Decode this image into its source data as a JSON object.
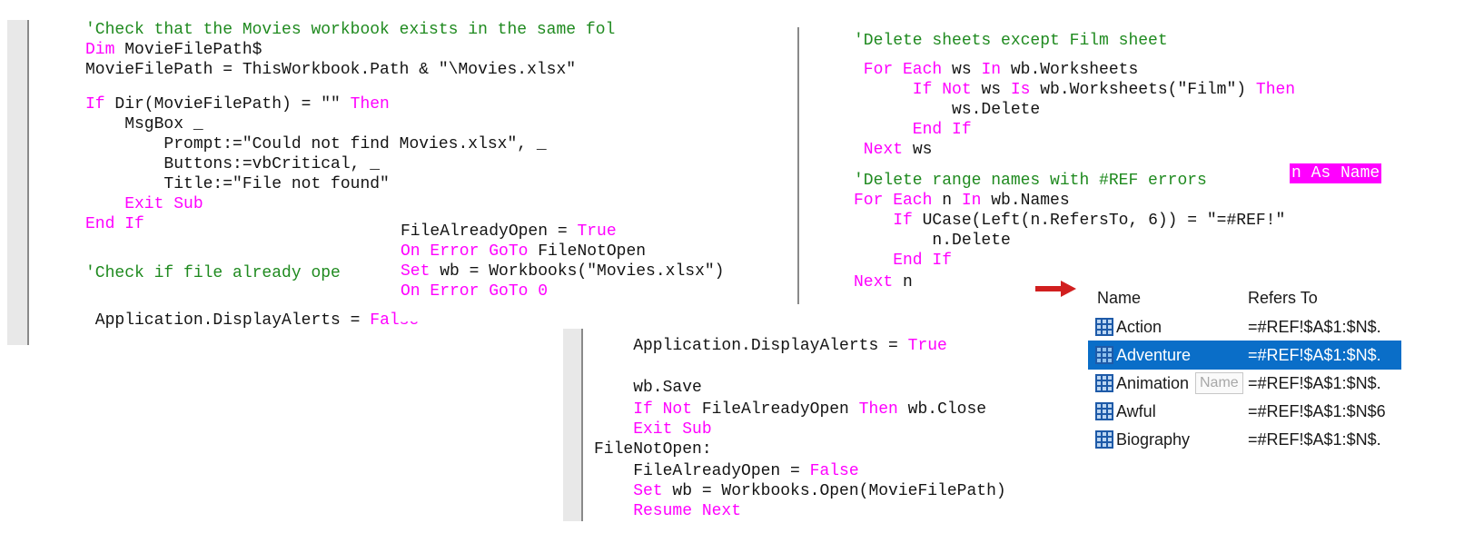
{
  "colors": {
    "keyword": "#ff00ff",
    "comment": "#1f8a1f",
    "text": "#141414",
    "gutter": "#e8e8e8",
    "selection": "#0a6ec8",
    "arrow": "#d11f1f"
  },
  "panel1": {
    "lines": [
      {
        "parts": [
          {
            "t": "c",
            "v": "'Check that the Movies workbook exists in the same fol"
          }
        ]
      },
      {
        "parts": [
          {
            "t": "k",
            "v": "Dim "
          },
          {
            "t": "s",
            "v": "MovieFilePath$"
          }
        ]
      },
      {
        "parts": [
          {
            "t": "s",
            "v": "MovieFilePath = ThisWorkbook.Path & \"\\Movies.xlsx\""
          }
        ]
      },
      {
        "parts": [
          {
            "t": "k",
            "v": "If "
          },
          {
            "t": "s",
            "v": "Dir(MovieFilePath) = \"\" "
          },
          {
            "t": "k",
            "v": "Then"
          }
        ]
      },
      {
        "parts": [
          {
            "t": "s",
            "v": "    MsgBox _"
          }
        ]
      },
      {
        "parts": [
          {
            "t": "s",
            "v": "        Prompt:=\"Could not find Movies.xlsx\", _"
          }
        ]
      },
      {
        "parts": [
          {
            "t": "s",
            "v": "        Buttons:=vbCritical, _"
          }
        ]
      },
      {
        "parts": [
          {
            "t": "s",
            "v": "        Title:=\"File not found\""
          }
        ]
      },
      {
        "parts": [
          {
            "t": "k",
            "v": "    Exit Sub"
          }
        ]
      },
      {
        "parts": [
          {
            "t": "k",
            "v": "End If"
          }
        ]
      },
      {
        "parts": [
          {
            "t": "c",
            "v": "'Check if file already ope"
          }
        ]
      },
      {
        "parts": [
          {
            "t": "s",
            "v": " Application.DisplayAlerts = "
          },
          {
            "t": "k",
            "v": "False"
          }
        ]
      }
    ],
    "inset_lines": [
      {
        "parts": [
          {
            "t": "s",
            "v": "FileAlreadyOpen = "
          },
          {
            "t": "k",
            "v": "True"
          }
        ]
      },
      {
        "parts": [
          {
            "t": "k",
            "v": "On Error GoTo "
          },
          {
            "t": "s",
            "v": "FileNotOpen"
          }
        ]
      },
      {
        "parts": [
          {
            "t": "k",
            "v": "Set "
          },
          {
            "t": "s",
            "v": "wb = Workbooks(\"Movies.xlsx\")"
          }
        ]
      },
      {
        "parts": [
          {
            "t": "k",
            "v": "On Error GoTo 0"
          }
        ]
      }
    ]
  },
  "panel2": {
    "lines": [
      {
        "parts": [
          {
            "t": "c",
            "v": "'Delete sheets except Film sheet"
          }
        ]
      },
      {
        "parts": [
          {
            "t": "k",
            "v": " For Each "
          },
          {
            "t": "s",
            "v": "ws "
          },
          {
            "t": "k",
            "v": "In "
          },
          {
            "t": "s",
            "v": "wb.Worksheets"
          }
        ]
      },
      {
        "parts": [
          {
            "t": "k",
            "v": "      If Not "
          },
          {
            "t": "s",
            "v": "ws "
          },
          {
            "t": "k",
            "v": "Is "
          },
          {
            "t": "s",
            "v": "wb.Worksheets(\"Film\") "
          },
          {
            "t": "k",
            "v": "Then"
          }
        ]
      },
      {
        "parts": [
          {
            "t": "s",
            "v": "          ws.Delete"
          }
        ]
      },
      {
        "parts": [
          {
            "t": "k",
            "v": "      End If"
          }
        ]
      },
      {
        "parts": [
          {
            "t": "k",
            "v": " Next "
          },
          {
            "t": "s",
            "v": "ws"
          }
        ]
      },
      {
        "parts": [
          {
            "t": "c",
            "v": "'Delete range names with #REF errors"
          }
        ]
      },
      {
        "parts": [
          {
            "t": "k",
            "v": "For Each "
          },
          {
            "t": "s",
            "v": "n "
          },
          {
            "t": "k",
            "v": "In "
          },
          {
            "t": "s",
            "v": "wb.Names"
          }
        ]
      },
      {
        "parts": [
          {
            "t": "k",
            "v": "    If "
          },
          {
            "t": "s",
            "v": "UCase(Left(n.RefersTo, 6)) = \"=#REF!\""
          }
        ]
      },
      {
        "parts": [
          {
            "t": "s",
            "v": "        n.Delete"
          }
        ]
      },
      {
        "parts": [
          {
            "t": "k",
            "v": "    End If"
          }
        ]
      },
      {
        "parts": [
          {
            "t": "k",
            "v": "Next "
          },
          {
            "t": "s",
            "v": "n"
          }
        ]
      }
    ],
    "highlight": "n As Name"
  },
  "panel3": {
    "lines": [
      {
        "parts": [
          {
            "t": "s",
            "v": "    Application.DisplayAlerts = "
          },
          {
            "t": "k",
            "v": "True"
          }
        ]
      },
      {
        "parts": [
          {
            "t": "s",
            "v": "    wb.Save"
          }
        ]
      },
      {
        "parts": [
          {
            "t": "k",
            "v": "    If Not "
          },
          {
            "t": "s",
            "v": "FileAlreadyOpen "
          },
          {
            "t": "k",
            "v": "Then "
          },
          {
            "t": "s",
            "v": "wb.Close"
          }
        ]
      },
      {
        "parts": [
          {
            "t": "k",
            "v": "    Exit Sub"
          }
        ]
      },
      {
        "parts": [
          {
            "t": "s",
            "v": "FileNotOpen:"
          }
        ]
      },
      {
        "parts": [
          {
            "t": "s",
            "v": "    FileAlreadyOpen = "
          },
          {
            "t": "k",
            "v": "False"
          }
        ]
      },
      {
        "parts": [
          {
            "t": "k",
            "v": "    Set "
          },
          {
            "t": "s",
            "v": "wb = Workbooks.Open(MovieFilePath)"
          }
        ]
      },
      {
        "parts": [
          {
            "t": "k",
            "v": "    Resume Next"
          }
        ]
      }
    ]
  },
  "name_manager": {
    "header_name": "Name",
    "header_refers": "Refers To",
    "rows": [
      {
        "name": "Action",
        "refers": "=#REF!$A$1:$N$."
      },
      {
        "name": "Adventure",
        "refers": "=#REF!$A$1:$N$."
      },
      {
        "name": "Animation",
        "refers": "=#REF!$A$1:$N$."
      },
      {
        "name": "Awful",
        "refers": "=#REF!$A$1:$N$6"
      },
      {
        "name": "Biography",
        "refers": "=#REF!$A$1:$N$."
      }
    ],
    "selected_index": 1,
    "tooltip": "Name"
  }
}
